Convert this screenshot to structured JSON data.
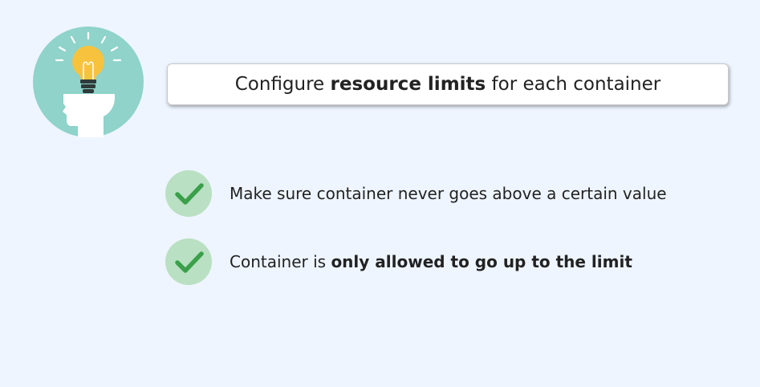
{
  "title": {
    "prefix": "Configure ",
    "bold": "resource limits",
    "suffix": " for each container"
  },
  "icons": {
    "idea": "lightbulb-head-icon",
    "check": "checkmark-icon"
  },
  "bullets": [
    {
      "text": "Make sure container never goes above a certain value",
      "bold": "",
      "after": ""
    },
    {
      "text": "Container is ",
      "bold": "only allowed to go up to the limit",
      "after": ""
    }
  ],
  "colors": {
    "background": "#eef5ff",
    "icon_circle": "#8fd3ca",
    "bulb": "#f7c33e",
    "check_circle": "#b9e0c2",
    "check_mark": "#3aa04a"
  }
}
